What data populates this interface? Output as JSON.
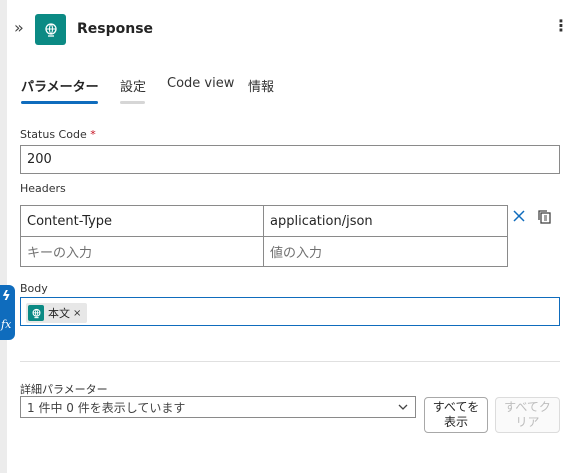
{
  "header": {
    "title": "Response",
    "collapse_glyph": "»",
    "more_glyph": "⋮",
    "icon": "app-globe-icon"
  },
  "tabs": [
    {
      "label": "パラメーター",
      "active": true
    },
    {
      "label": "設定"
    },
    {
      "label": "Code view"
    },
    {
      "label": "情報"
    }
  ],
  "status_code": {
    "label": "Status Code",
    "required_mark": "*",
    "value": "200"
  },
  "headers": {
    "label": "Headers",
    "rows": [
      {
        "key": "Content-Type",
        "value": "application/json"
      }
    ],
    "key_placeholder": "キーの入力",
    "value_placeholder": "値の入力"
  },
  "body": {
    "label": "Body",
    "token_label": "本文",
    "token_remove": "×"
  },
  "side_pill": {
    "lightning_glyph": "ϟ",
    "fx_label": "fx"
  },
  "advanced": {
    "label": "詳細パラメーター",
    "select_text": "1 件中 0 件を表示しています",
    "show_all_label": "すべてを\n表示",
    "clear_all_label": "すべてク\nリア"
  },
  "colors": {
    "accent": "#0f6cbd",
    "app_icon_bg": "#0b8a84",
    "required": "#c50f1f"
  }
}
